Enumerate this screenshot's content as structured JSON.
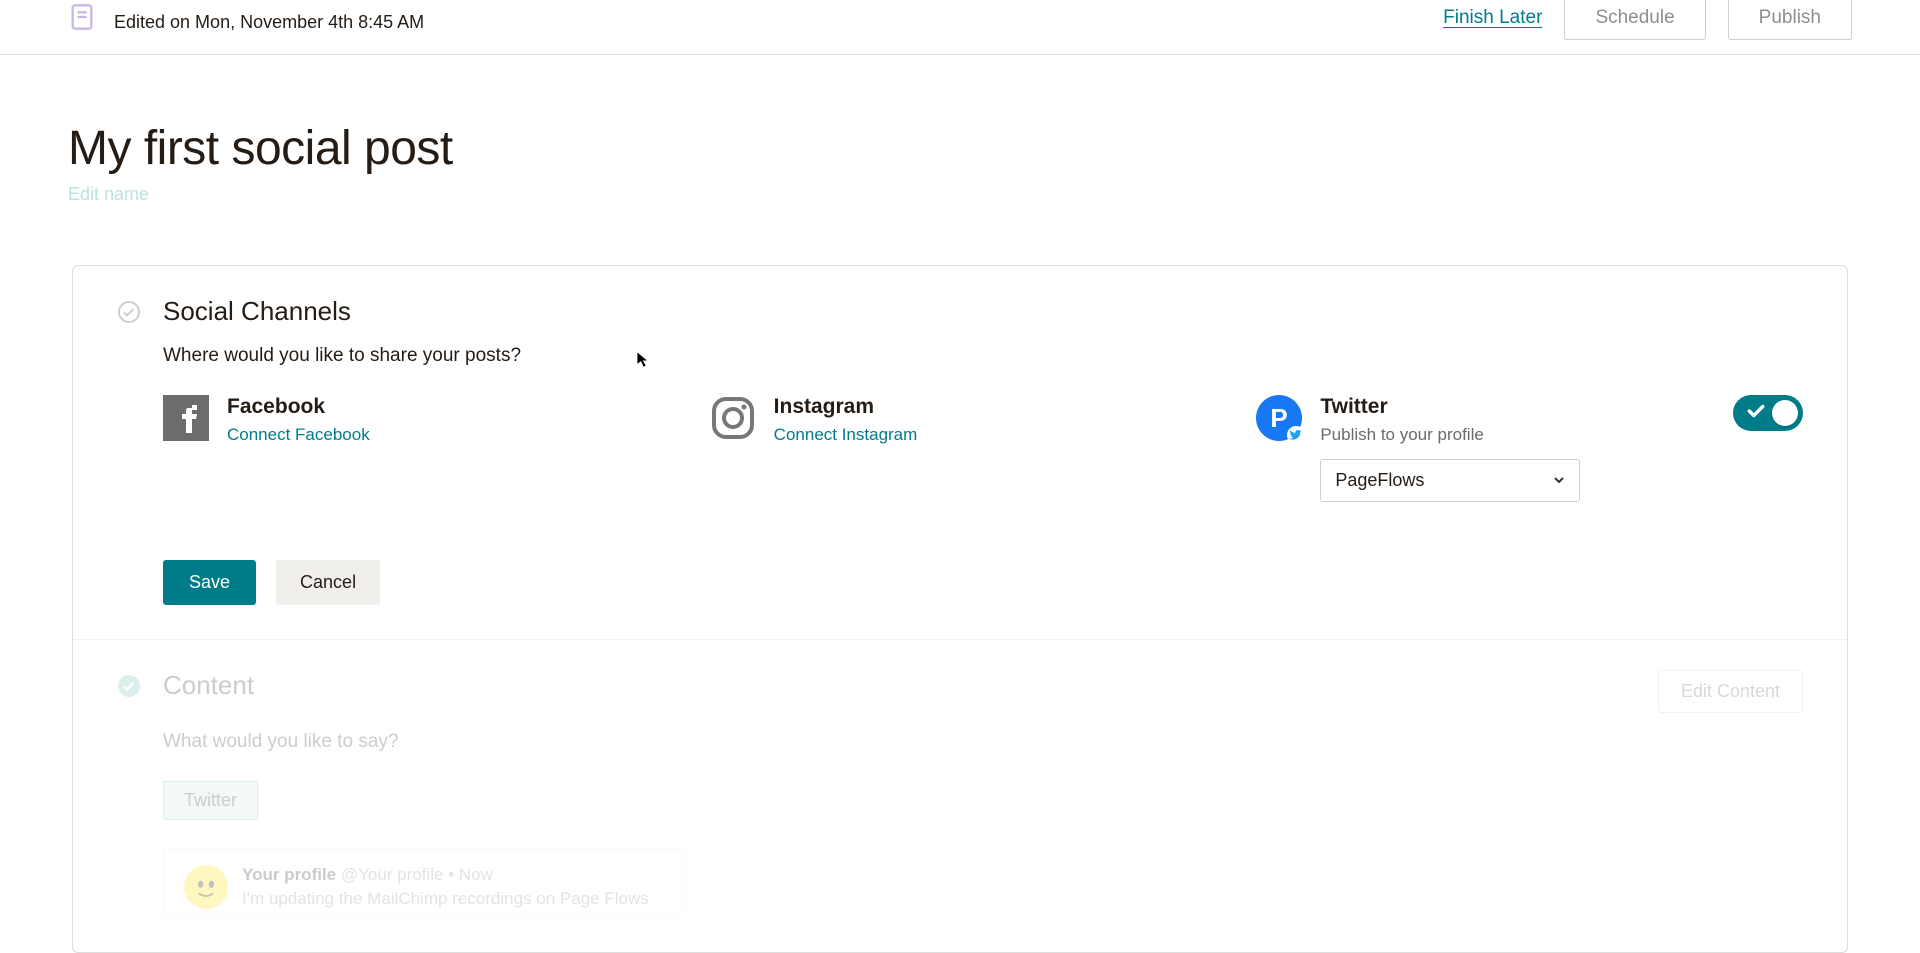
{
  "topbar": {
    "edited_text": "Edited on Mon, November 4th 8:45 AM",
    "finish_later": "Finish Later",
    "schedule": "Schedule",
    "publish": "Publish"
  },
  "page": {
    "title": "My first social post",
    "edit_name": "Edit name"
  },
  "social_channels": {
    "title": "Social Channels",
    "subtitle": "Where would you like to share your posts?",
    "facebook": {
      "name": "Facebook",
      "action": "Connect Facebook"
    },
    "instagram": {
      "name": "Instagram",
      "action": "Connect Instagram"
    },
    "twitter": {
      "name": "Twitter",
      "subtitle": "Publish to your profile",
      "selected_profile": "PageFlows",
      "toggle_on": true
    },
    "save": "Save",
    "cancel": "Cancel"
  },
  "content": {
    "title": "Content",
    "subtitle": "What would you like to say?",
    "edit_button": "Edit Content",
    "chip": "Twitter",
    "preview": {
      "name": "Your profile",
      "handle_time": "@Your profile • Now",
      "text": "I'm updating the MailChimp recordings on Page Flows"
    }
  }
}
